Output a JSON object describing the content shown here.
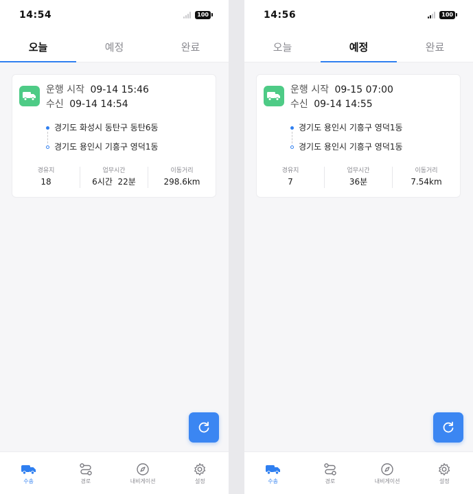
{
  "screens": [
    {
      "status": {
        "time": "14:54",
        "battery": "100"
      },
      "tabs": [
        "오늘",
        "예정",
        "완료"
      ],
      "active_tab": 0,
      "card": {
        "start_label": "운행 시작",
        "start_value": "09-14 15:46",
        "receive_label": "수신",
        "receive_value": "09-14 14:54",
        "origin": "경기도 화성시 동탄구 동탄6동",
        "destination": "경기도 용인시 기흥구 영덕1동",
        "stats": [
          {
            "label": "경유지",
            "value": "18"
          },
          {
            "label": "업무시간",
            "value": "6시간  22분"
          },
          {
            "label": "이동거리",
            "value": "298.6km"
          }
        ]
      },
      "nav": [
        "수송",
        "경로",
        "내비게이션",
        "설정"
      ]
    },
    {
      "status": {
        "time": "14:56",
        "battery": "100"
      },
      "tabs": [
        "오늘",
        "예정",
        "완료"
      ],
      "active_tab": 1,
      "card": {
        "start_label": "운행 시작",
        "start_value": "09-15 07:00",
        "receive_label": "수신",
        "receive_value": "09-14 14:55",
        "origin": "경기도 용인시 기흥구 영덕1동",
        "destination": "경기도 용인시 기흥구 영덕1동",
        "stats": [
          {
            "label": "경유지",
            "value": "7"
          },
          {
            "label": "업무시간",
            "value": "36분"
          },
          {
            "label": "이동거리",
            "value": "7.54km"
          }
        ]
      },
      "nav": [
        "수송",
        "경로",
        "내비게이션",
        "설정"
      ]
    }
  ],
  "colors": {
    "accent": "#2f7ff0",
    "truck_badge": "#4ecb86",
    "fab": "#3b86f2"
  },
  "icons": {
    "card": "truck-icon",
    "fab": "refresh-icon",
    "nav": [
      "truck-icon",
      "route-icon",
      "compass-icon",
      "gear-icon"
    ]
  }
}
